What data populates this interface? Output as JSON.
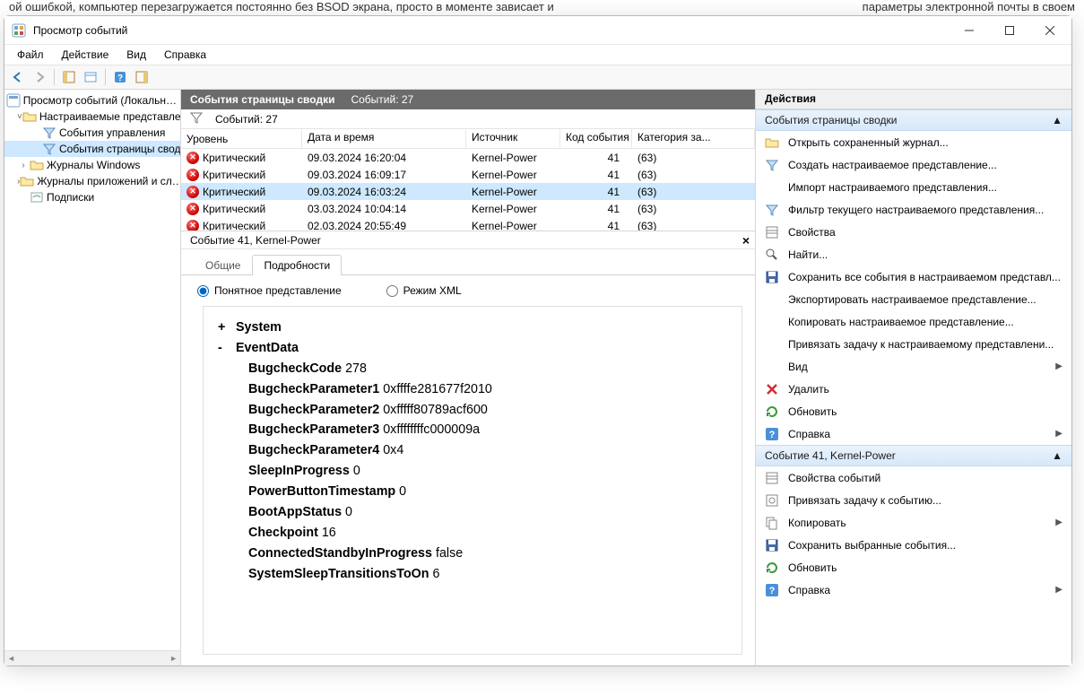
{
  "bg": {
    "left": "ой ошибкой, компьютер перезагружается постоянно без BSOD экрана, просто в моменте зависает и",
    "right": "параметры электронной почты в своем"
  },
  "window": {
    "title": "Просмотр событий"
  },
  "menu": {
    "file": "Файл",
    "action": "Действие",
    "view": "Вид",
    "help": "Справка"
  },
  "tree": {
    "root": "Просмотр событий (Локальн…",
    "custom": "Настраиваемые представле…",
    "admin": "События управления",
    "summary": "События страницы свод…",
    "winlogs": "Журналы Windows",
    "applogs": "Журналы приложений и сл…",
    "subs": "Подписки"
  },
  "center": {
    "strip": "События страницы сводки",
    "count_lbl": "Событий: 27",
    "filter_count": "Событий: 27",
    "cols": {
      "level": "Уровень",
      "dt": "Дата и время",
      "src": "Источник",
      "eid": "Код события",
      "cat": "Категория за..."
    },
    "rows": [
      {
        "lvl": "Критический",
        "dt": "09.03.2024 16:20:04",
        "src": "Kernel-Power",
        "eid": "41",
        "cat": "(63)",
        "sel": false
      },
      {
        "lvl": "Критический",
        "dt": "09.03.2024 16:09:17",
        "src": "Kernel-Power",
        "eid": "41",
        "cat": "(63)",
        "sel": false
      },
      {
        "lvl": "Критический",
        "dt": "09.03.2024 16:03:24",
        "src": "Kernel-Power",
        "eid": "41",
        "cat": "(63)",
        "sel": true
      },
      {
        "lvl": "Критический",
        "dt": "03.03.2024 10:04:14",
        "src": "Kernel-Power",
        "eid": "41",
        "cat": "(63)",
        "sel": false
      },
      {
        "lvl": "Критический",
        "dt": "02.03.2024 20:55:49",
        "src": "Kernel-Power",
        "eid": "41",
        "cat": "(63)",
        "sel": false
      }
    ]
  },
  "detail": {
    "title": "Событие 41, Kernel-Power",
    "tab_general": "Общие",
    "tab_details": "Подробности",
    "radio_friendly": "Понятное представление",
    "radio_xml": "Режим XML",
    "system": "System",
    "eventdata": "EventData",
    "kv": [
      {
        "k": "BugcheckCode",
        "v": "278"
      },
      {
        "k": "BugcheckParameter1",
        "v": "0xffffe281677f2010"
      },
      {
        "k": "BugcheckParameter2",
        "v": "0xfffff80789acf600"
      },
      {
        "k": "BugcheckParameter3",
        "v": "0xffffffffc000009a"
      },
      {
        "k": "BugcheckParameter4",
        "v": "0x4"
      },
      {
        "k": "SleepInProgress",
        "v": "0"
      },
      {
        "k": "PowerButtonTimestamp",
        "v": "0"
      },
      {
        "k": "BootAppStatus",
        "v": "0"
      },
      {
        "k": "Checkpoint",
        "v": "16"
      },
      {
        "k": "ConnectedStandbyInProgress",
        "v": "false"
      },
      {
        "k": "SystemSleepTransitionsToOn",
        "v": "6"
      }
    ]
  },
  "actions": {
    "title": "Действия",
    "sec1": "События страницы сводки",
    "sec2": "Событие 41, Kernel-Power",
    "a": {
      "open": "Открыть сохраненный журнал...",
      "create": "Создать настраиваемое представление...",
      "import": "Импорт настраиваемого представления...",
      "filter": "Фильтр текущего настраиваемого представления...",
      "props": "Свойства",
      "find": "Найти...",
      "saveall": "Сохранить все события в настраиваемом представл...",
      "export": "Экспортировать настраиваемое представление...",
      "copyview": "Копировать настраиваемое представление...",
      "attach": "Привязать задачу к настраиваемому представлени...",
      "view": "Вид",
      "delete": "Удалить",
      "refresh": "Обновить",
      "help": "Справка",
      "evprops": "Свойства событий",
      "evattach": "Привязать задачу к событию...",
      "copy": "Копировать",
      "savesel": "Сохранить выбранные события...",
      "refresh2": "Обновить",
      "help2": "Справка"
    }
  }
}
